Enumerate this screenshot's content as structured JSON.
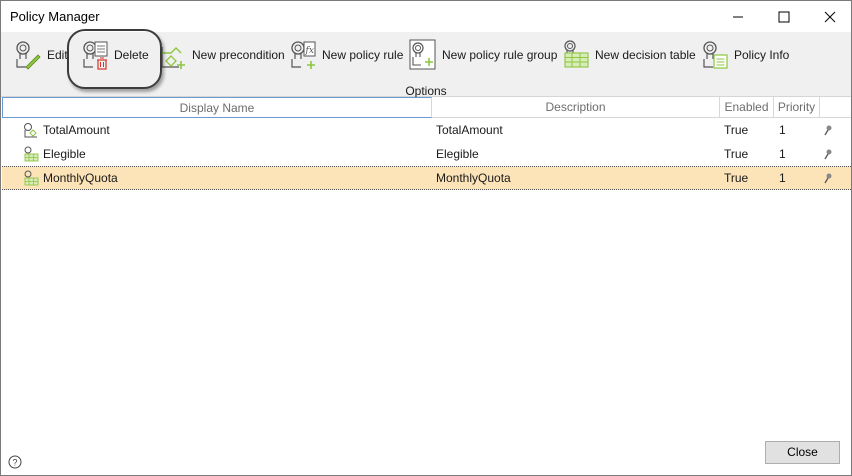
{
  "window": {
    "title": "Policy Manager"
  },
  "toolbar": {
    "buttons": [
      {
        "label": "Edit",
        "icon": "edit-policy-icon"
      },
      {
        "label": "Delete",
        "icon": "delete-policy-icon"
      },
      {
        "label": "New precondition",
        "icon": "new-precondition-icon"
      },
      {
        "label": "New policy rule",
        "icon": "new-policy-rule-icon"
      },
      {
        "label": "New policy rule group",
        "icon": "new-policy-rule-group-icon"
      },
      {
        "label": "New decision table",
        "icon": "new-decision-table-icon"
      },
      {
        "label": "Policy Info",
        "icon": "policy-info-icon"
      }
    ],
    "group_label": "Options"
  },
  "grid": {
    "columns": [
      "Display Name",
      "Description",
      "Enabled",
      "Priority"
    ],
    "rows": [
      {
        "name": "TotalAmount",
        "description": "TotalAmount",
        "enabled": "True",
        "priority": "1",
        "icon": "precondition-icon",
        "selected": false
      },
      {
        "name": "Elegible",
        "description": "Elegible",
        "enabled": "True",
        "priority": "1",
        "icon": "decision-table-icon",
        "selected": false
      },
      {
        "name": "MonthlyQuota",
        "description": "MonthlyQuota",
        "enabled": "True",
        "priority": "1",
        "icon": "decision-table-icon",
        "selected": true
      }
    ]
  },
  "footer": {
    "close_label": "Close",
    "help_icon": "help-icon"
  },
  "colors": {
    "selected_row": "#fce3b8",
    "icon_green": "#8dc63f",
    "delete_red": "#d9342b"
  }
}
